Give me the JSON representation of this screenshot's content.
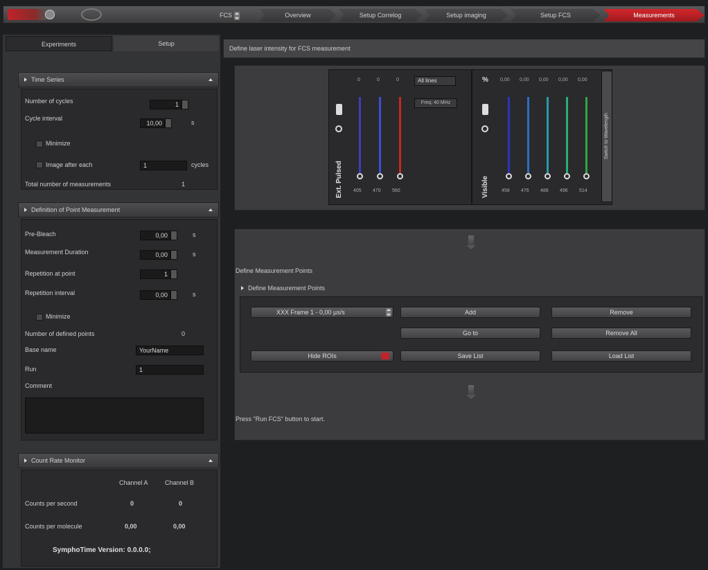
{
  "topbar": {
    "mode": "FCS",
    "steps": [
      "Overview",
      "Setup Correlog",
      "Setup imaging",
      "Setup FCS",
      "Measurements"
    ]
  },
  "tabs": [
    "Experiments",
    "Setup"
  ],
  "time_series": {
    "title": "Time Series",
    "cycles_label": "Number of cycles",
    "cycles_value": "1",
    "interval_label": "Cycle interval",
    "interval_value": "10,00",
    "interval_unit": "s",
    "minimize_label": "Minimize",
    "image_after_label": "Image after each",
    "image_after_value": "1",
    "image_after_unit": "cycles",
    "total_label": "Total number of measurements",
    "total_value": "1"
  },
  "point_measurement": {
    "title": "Definition of Point Measurement",
    "prebleach_label": "Pre-Bleach",
    "prebleach_value": "0,00",
    "duration_label": "Measurement Duration",
    "duration_value": "0,00",
    "rep_point_label": "Repetition at point",
    "rep_point_value": "1",
    "rep_interval_label": "Repetition interval",
    "rep_interval_value": "0,00",
    "unit_s": "s",
    "minimize_label": "Minimize",
    "defined_label": "Number of defined points",
    "defined_value": "0",
    "basename_label": "Base name",
    "basename_value": "YourName",
    "run_label": "Run",
    "run_value": "1",
    "comment_label": "Comment"
  },
  "count_rate": {
    "title": "Count Rate Monitor",
    "col_a": "Channel A",
    "col_b": "Channel B",
    "cps_label": "Counts per second",
    "cps_a": "0",
    "cps_b": "0",
    "cpm_label": "Counts per molecule",
    "cpm_a": "0,00",
    "cpm_b": "0,00",
    "version": "SymphoTime Version: 0.0.0.0;"
  },
  "laser": {
    "header": "Define laser intensity for FCS measurement",
    "pulsed_label": "Ext. Pulsed",
    "pulsed_mode": "All lines",
    "pulsed_freq": "Freq: 40 MHz",
    "pulsed_top": [
      "0",
      "0",
      "0"
    ],
    "pulsed_wl": [
      "405",
      "470",
      "560"
    ],
    "visible_label": "Visible",
    "visible_unit": "%",
    "visible_top": [
      "0,00",
      "0,00",
      "0,00",
      "0,00",
      "0,00"
    ],
    "visible_wl": [
      "458",
      "476",
      "488",
      "496",
      "514"
    ],
    "side_label": "Switch to Wavelength",
    "colors": {
      "pulsed": [
        "#3a3ec0",
        "#3a4fd8",
        "#c02a20"
      ],
      "visible": [
        "#2a35b8",
        "#2e6ec8",
        "#2a9aa8",
        "#27b07a",
        "#2fa844"
      ]
    }
  },
  "points": {
    "header": "Define Measurement Points",
    "section": "Define Measurement Points",
    "dropdown": "XXX Frame 1 - 0,00 µs/s",
    "add": "Add",
    "remove": "Remove",
    "goto": "Go to",
    "remove_all": "Remove All",
    "hide_roi": "Hide ROIs",
    "save_list": "Save List",
    "load_list": "Load List"
  },
  "footer_msg": "Press \"Run FCS\" button to start."
}
